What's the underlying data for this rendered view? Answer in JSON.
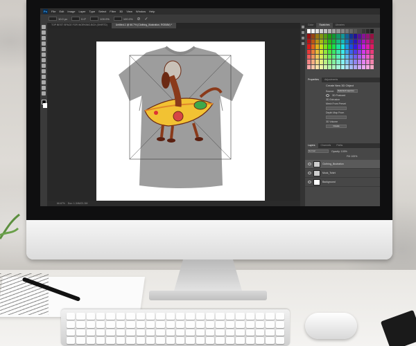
{
  "app": {
    "name": "Photoshop",
    "logo_text": "Ps",
    "menu": [
      "File",
      "Edit",
      "Image",
      "Layer",
      "Type",
      "Select",
      "Filter",
      "3D",
      "View",
      "Window",
      "Help"
    ]
  },
  "options_bar": {
    "fields": [
      "10.0 px",
      "0.0°",
      "100.0%",
      "100.0%"
    ]
  },
  "document_tab": {
    "active": "Untitled-1 @ 66.7% (Clothing_Illustration, RGB/8#) *",
    "inactive": "TOP BEST SPACE FOR WORKING.BOX (SHIRTD)"
  },
  "status_bar": {
    "zoom": "66.67%",
    "doc": "Doc: 1.34M/21.3M"
  },
  "panels": {
    "top_tabs": [
      "Color",
      "Swatches",
      "Libraries"
    ],
    "active_top_tab": "Swatches",
    "properties": {
      "tabs": [
        "Properties",
        "Adjustments"
      ],
      "title": "Create New 3D Object",
      "source_label": "Source:",
      "source_value": "Selected Layer(s)",
      "options": [
        "3D Postcard",
        "3D Extrusion",
        "Mesh From Preset",
        "Depth Map From",
        "3D Volume"
      ],
      "create_label": "Create"
    },
    "layers": {
      "tabs": [
        "Layers",
        "Channels",
        "Paths"
      ],
      "blend_mode": "Normal",
      "opacity": "Opacity: 100%",
      "fill": "Fill: 100%",
      "items": [
        {
          "name": "Clothing_Illustration",
          "selected": true
        },
        {
          "name": "Mock_Tshirt",
          "selected": false
        },
        {
          "name": "Background",
          "selected": false
        }
      ]
    }
  },
  "colors": {
    "screen_bg": "#282828",
    "panel_bg": "#474747",
    "accent": "#31a8ff",
    "shirt": "#9d9d9d"
  },
  "icons": [
    "move-icon",
    "marquee-icon",
    "lasso-icon",
    "crop-icon",
    "eyedropper-icon",
    "brush-icon",
    "eraser-icon",
    "gradient-icon",
    "pen-icon",
    "type-icon",
    "shape-icon",
    "hand-icon",
    "zoom-icon"
  ]
}
